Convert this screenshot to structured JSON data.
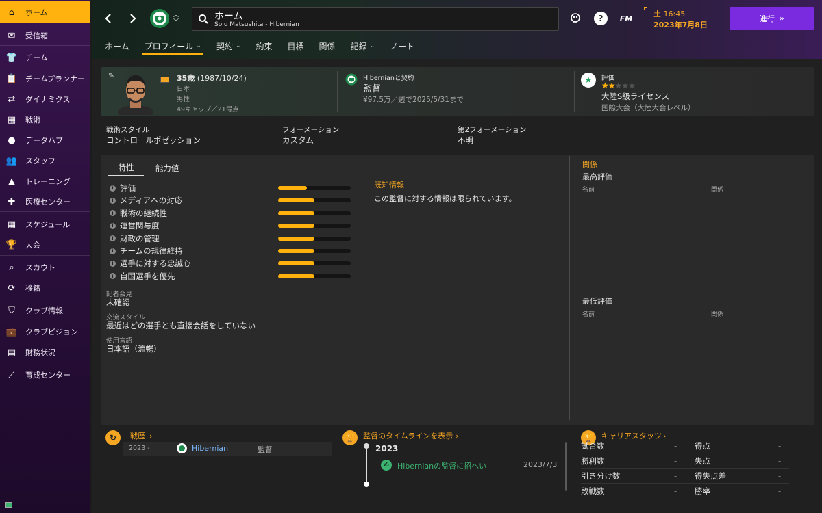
{
  "sidebar": {
    "items": [
      {
        "label": "ホーム",
        "icon": "home-icon"
      },
      {
        "label": "受信箱",
        "icon": "inbox-icon"
      },
      {
        "label": "チーム",
        "icon": "shirt-icon"
      },
      {
        "label": "チームプランナー",
        "icon": "clipboard-icon"
      },
      {
        "label": "ダイナミクス",
        "icon": "dynamics-icon"
      },
      {
        "label": "戦術",
        "icon": "tactics-icon"
      },
      {
        "label": "データハブ",
        "icon": "data-hub-icon"
      },
      {
        "label": "スタッフ",
        "icon": "staff-icon"
      },
      {
        "label": "トレーニング",
        "icon": "training-icon"
      },
      {
        "label": "医療センター",
        "icon": "medical-icon"
      },
      {
        "label": "スケジュール",
        "icon": "calendar-icon"
      },
      {
        "label": "大会",
        "icon": "trophy-icon"
      },
      {
        "label": "スカウト",
        "icon": "scout-icon"
      },
      {
        "label": "移籍",
        "icon": "transfer-icon"
      },
      {
        "label": "クラブ情報",
        "icon": "shield-icon"
      },
      {
        "label": "クラブビジョン",
        "icon": "briefcase-icon"
      },
      {
        "label": "財務状況",
        "icon": "finance-icon"
      },
      {
        "label": "育成センター",
        "icon": "development-icon"
      }
    ]
  },
  "header": {
    "title": "ホーム",
    "subtitle": "Soju Matsushita - Hibernian",
    "fm_label": "FM",
    "day_time": "土 16:45",
    "date": "2023年7月8日",
    "continue_label": "進行",
    "tabs": [
      {
        "label": "ホーム",
        "chevron": false
      },
      {
        "label": "プロフィール",
        "chevron": true
      },
      {
        "label": "契約",
        "chevron": true
      },
      {
        "label": "約束",
        "chevron": false
      },
      {
        "label": "目標",
        "chevron": false
      },
      {
        "label": "関係",
        "chevron": false
      },
      {
        "label": "記録",
        "chevron": true
      },
      {
        "label": "ノート",
        "chevron": false
      }
    ]
  },
  "profile": {
    "age": "35歳",
    "dob": "(1987/10/24)",
    "nationality": "日本",
    "gender": "男性",
    "caps": "49キャップ／21得点",
    "contract_club": "Hibernianと契約",
    "role": "監督",
    "salary": "¥97.5万／週で2025/5/31まで",
    "rating_label": "評価",
    "rating_stars": 2,
    "rating_max": 5,
    "license": "大陸S級ライセンス",
    "reputation": "国際大会（大陸大会レベル）"
  },
  "tactics": {
    "style_label": "戦術スタイル",
    "style_value": "コントロールポゼッション",
    "formation_label": "フォーメーション",
    "formation_value": "カスタム",
    "second_formation_label": "第2フォーメーション",
    "second_formation_value": "不明"
  },
  "panel": {
    "tab1": "特性",
    "tab2": "能力値",
    "attributes": [
      {
        "label": "評価",
        "value": 0.4
      },
      {
        "label": "メディアへの対応",
        "value": 0.5
      },
      {
        "label": "戦術の継続性",
        "value": 0.5
      },
      {
        "label": "運営関与度",
        "value": 0.5
      },
      {
        "label": "財政の管理",
        "value": 0.5
      },
      {
        "label": "チームの規律維持",
        "value": 0.5
      },
      {
        "label": "選手に対する忠誠心",
        "value": 0.5
      },
      {
        "label": "自国選手を優先",
        "value": 0.5
      }
    ],
    "press_label": "記者会見",
    "press_value": "未確認",
    "comm_label": "交流スタイル",
    "comm_value": "最近はどの選手とも直接会話をしていない",
    "lang_label": "使用言語",
    "lang_value": "日本語（流暢）",
    "known_title": "既知情報",
    "known_text": "この監督に対する情報は限られています。",
    "rel_title": "関係",
    "best_title": "最高評価",
    "worst_title": "最低評価",
    "col_name": "名前",
    "col_rel": "関係"
  },
  "history": {
    "title": "戦歴",
    "year": "2023 -",
    "club": "Hibernian",
    "role": "監督"
  },
  "timeline": {
    "title": "監督のタイムラインを表示",
    "year": "2023",
    "event": "Hibernianの監督に招へい",
    "date": "2023/7/3"
  },
  "career": {
    "title": "キャリアスタッツ",
    "rows": [
      {
        "l1": "試合数",
        "v1": "-",
        "l2": "得点",
        "v2": "-"
      },
      {
        "l1": "勝利数",
        "v1": "-",
        "l2": "失点",
        "v2": "-"
      },
      {
        "l1": "引き分け数",
        "v1": "-",
        "l2": "得失点差",
        "v2": "-"
      },
      {
        "l1": "敗戦数",
        "v1": "-",
        "l2": "勝率",
        "v2": "-"
      }
    ]
  },
  "colors": {
    "accent": "#ffb20d",
    "link": "#f5a623",
    "club_green": "#1e8a4c",
    "continue": "#7a2be0"
  }
}
